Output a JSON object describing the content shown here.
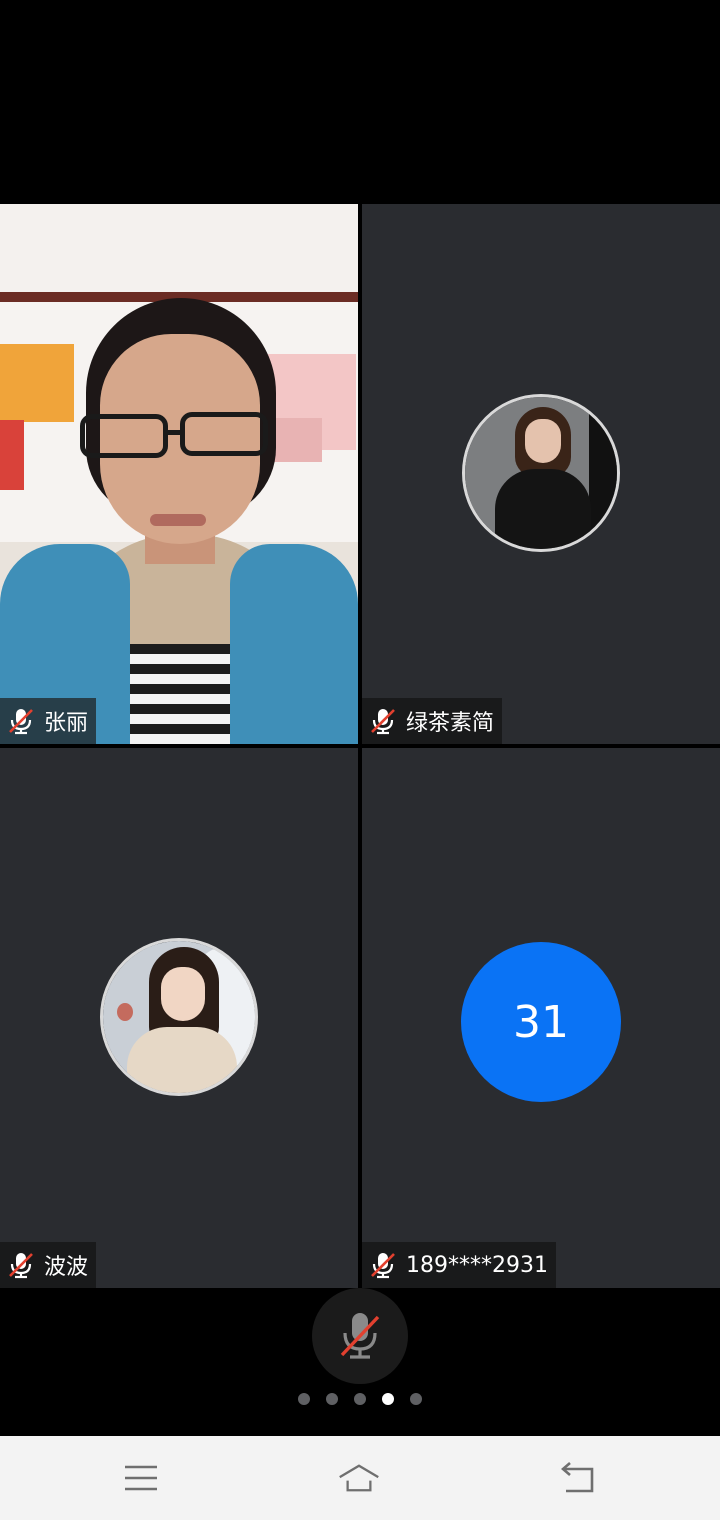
{
  "participants": [
    {
      "name": "张丽",
      "mic": "muted",
      "media": "video"
    },
    {
      "name": "绿茶素简",
      "mic": "muted",
      "media": "avatar-photo"
    },
    {
      "name": "波波",
      "mic": "muted",
      "media": "avatar-photo"
    },
    {
      "name": "189****2931",
      "mic": "muted",
      "media": "number-avatar",
      "avatar_text": "31",
      "avatar_color": "#0a73f5"
    }
  ],
  "controls": {
    "mute_button_icon": "mic-muted-icon",
    "mute_slash_color": "#e2402f"
  },
  "pager": {
    "total_pages": 5,
    "active_page": 4
  },
  "system_nav": {
    "menu_icon": "menu-icon",
    "home_icon": "home-icon",
    "back_icon": "back-icon"
  }
}
